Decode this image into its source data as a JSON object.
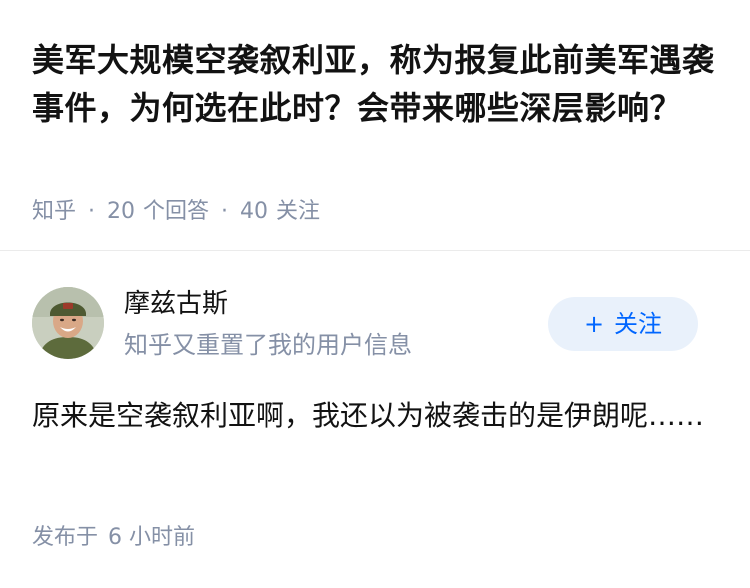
{
  "question": {
    "title": "美军大规模空袭叙利亚，称为报复此前美军遇袭事件，为何选在此时？会带来哪些深层影响？",
    "site": "知乎",
    "separator": "·",
    "answer_count": "20",
    "answer_label": "个回答",
    "follower_count": "40",
    "follower_label": "关注"
  },
  "answer": {
    "author": {
      "name": "摩兹古斯",
      "bio": "知乎又重置了我的用户信息",
      "avatar_icon": "user-avatar-photo"
    },
    "follow_button": {
      "icon": "plus-icon",
      "plus": "+",
      "label": "关注"
    },
    "content": "原来是空袭叙利亚啊，我还以为被袭击的是伊朗呢……",
    "posted_prefix": "发布于",
    "posted_time": "6 小时前"
  },
  "colors": {
    "text": "#121212",
    "meta": "#8590a6",
    "accent": "#0066ff",
    "button_bg": "#e9f1fb",
    "divider": "#ebebeb"
  }
}
